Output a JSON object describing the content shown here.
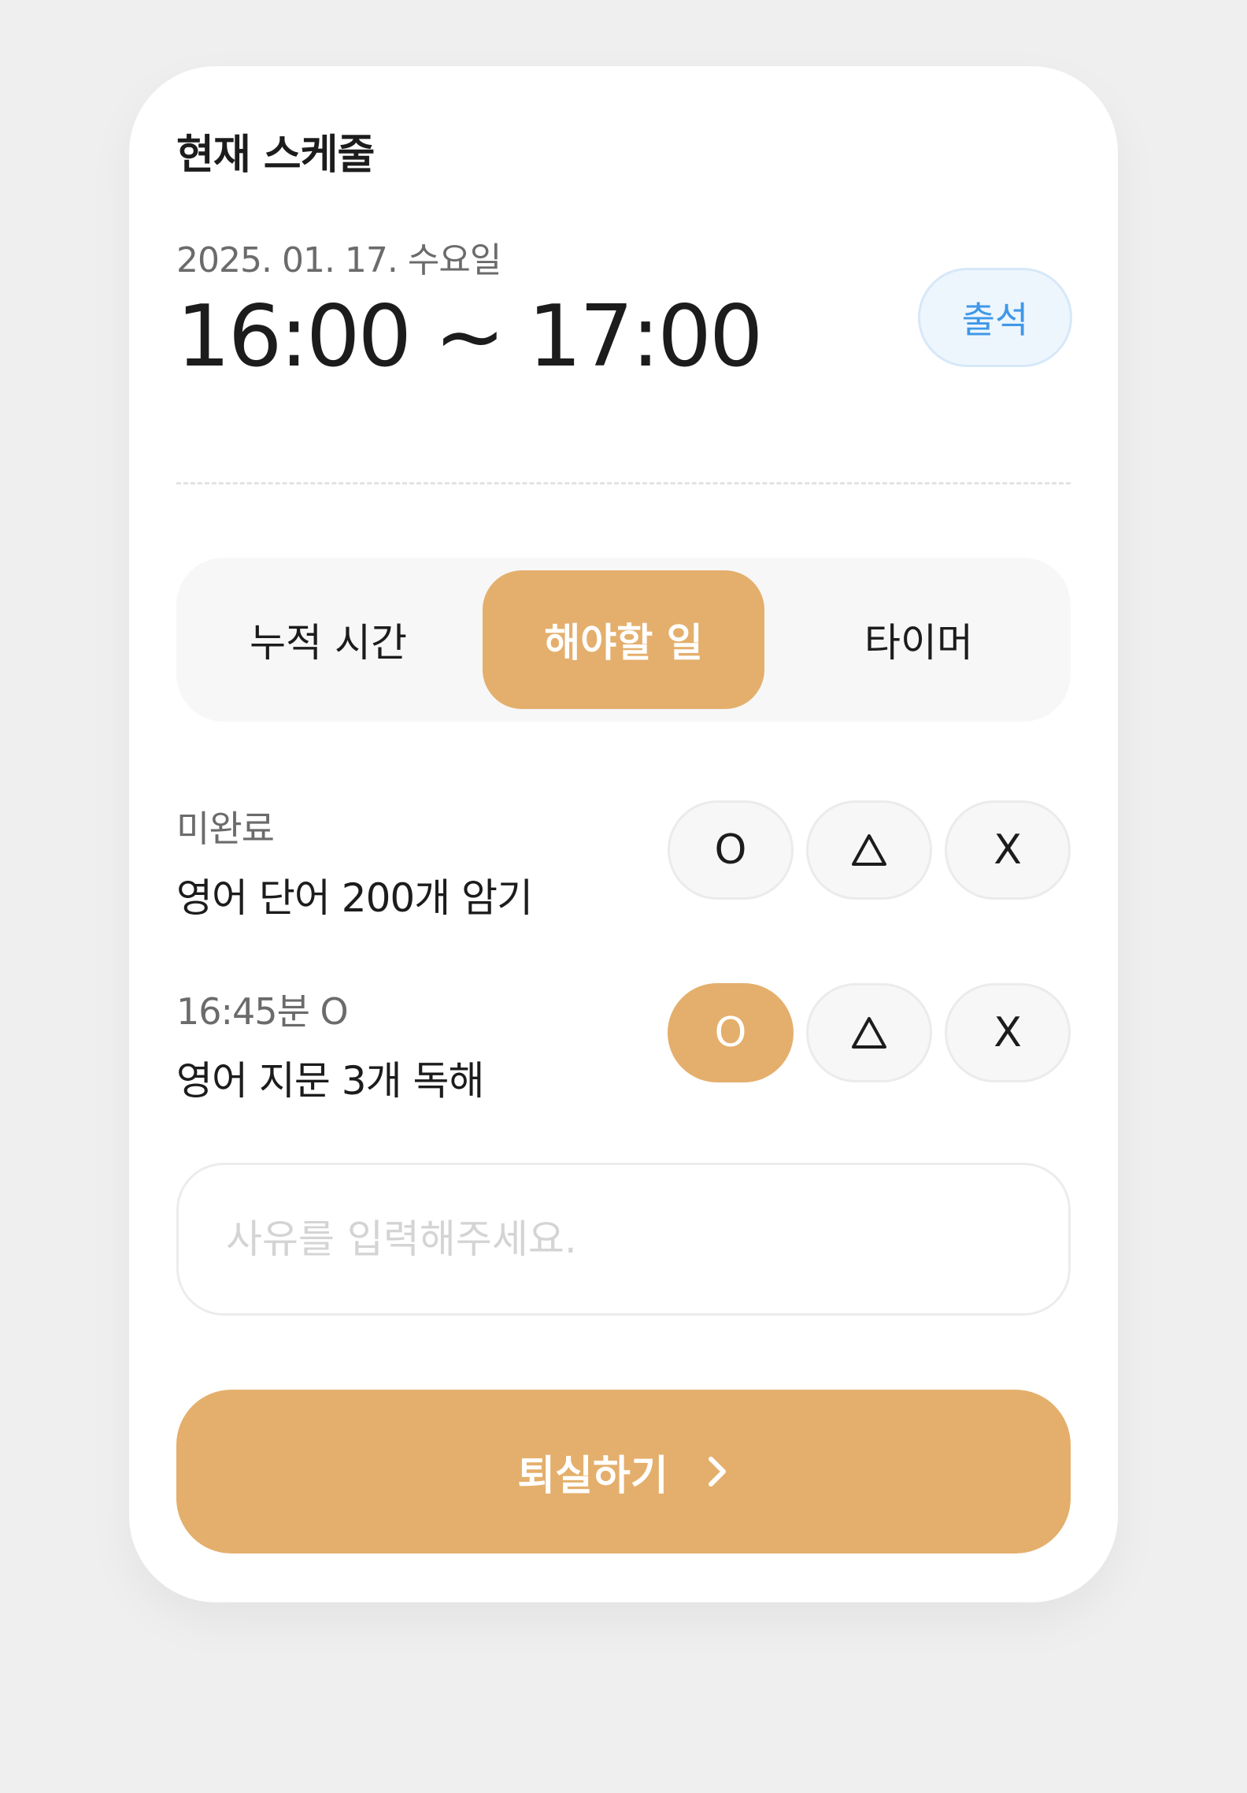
{
  "card": {
    "title": "현재 스케줄",
    "date": "2025. 01. 17. 수요일",
    "time_range": "16:00 ~ 17:00",
    "attend_label": "출석"
  },
  "tabs": [
    {
      "label": "누적 시간",
      "active": false
    },
    {
      "label": "해야할 일",
      "active": true
    },
    {
      "label": "타이머",
      "active": false
    }
  ],
  "tasks": [
    {
      "status": "미완료",
      "name": "영어 단어 200개 암기",
      "selected": "none"
    },
    {
      "status": "16:45분 O",
      "name": "영어 지문 3개 독해",
      "selected": "O"
    }
  ],
  "eval_options": {
    "o": "O",
    "triangle": "triangle-icon",
    "x": "X"
  },
  "reason_input": {
    "placeholder": "사유를 입력해주세요.",
    "value": ""
  },
  "leave_button": {
    "label": "퇴실하기",
    "icon": "chevron-right-icon"
  },
  "colors": {
    "accent": "#e4af6c",
    "attend_text": "#3f98e8",
    "attend_bg": "#eef6fd",
    "text": "#1c1c1c",
    "muted": "#6b6b6b",
    "page_bg": "#efefef"
  }
}
